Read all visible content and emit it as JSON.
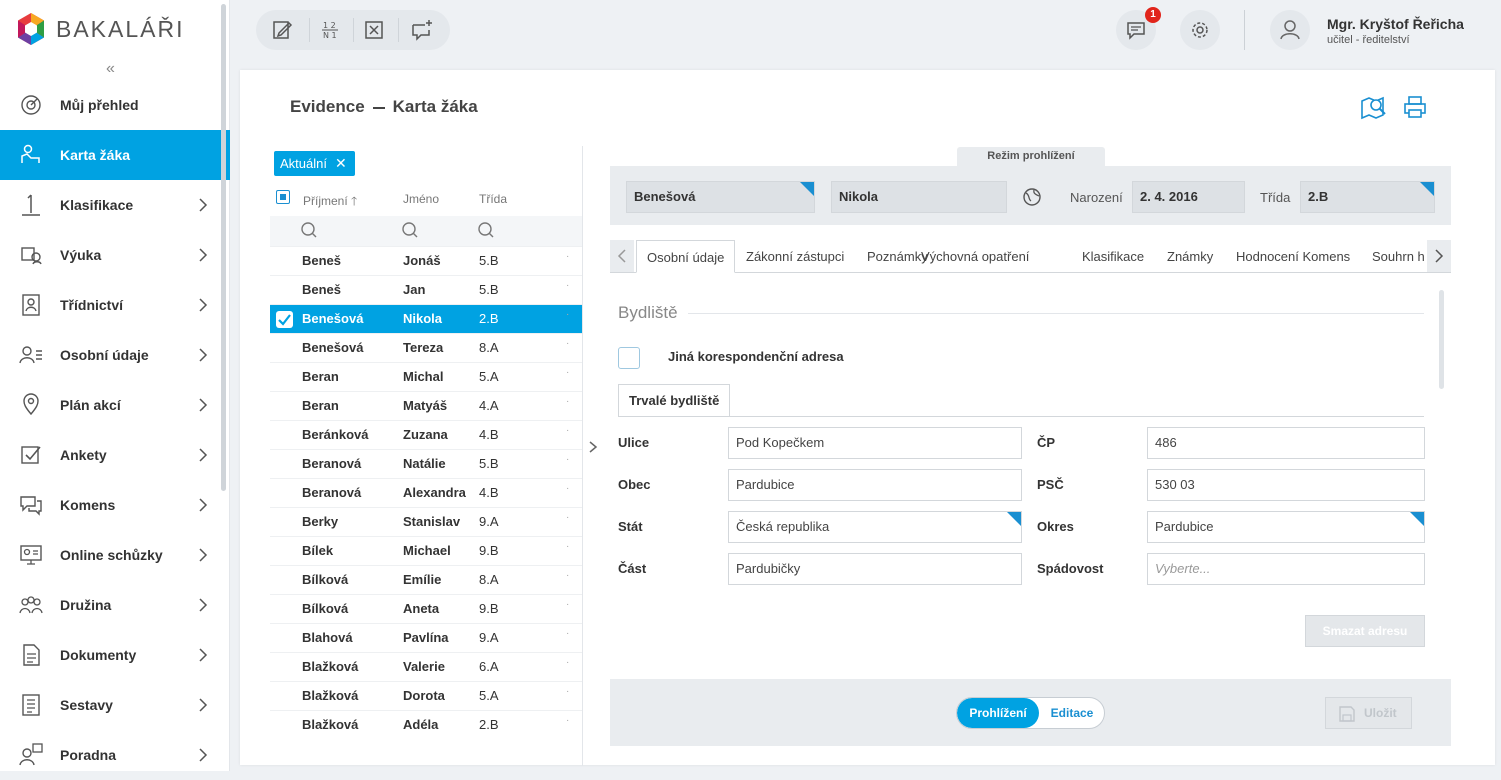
{
  "app": {
    "brand": "BAKALÁŘI",
    "user_name": "Mgr. Kryštof Řeřicha",
    "user_role": "učitel - ředitelství",
    "notif_count": "1",
    "accent": "#00a2e2"
  },
  "sidebar": {
    "items": [
      {
        "label": "Můj přehled",
        "icon": "dashboard-icon",
        "chevron": false
      },
      {
        "label": "Karta žáka",
        "icon": "student-card-icon",
        "chevron": false,
        "active": true
      },
      {
        "label": "Klasifikace",
        "icon": "grade-one-icon",
        "chevron": true
      },
      {
        "label": "Výuka",
        "icon": "teaching-icon",
        "chevron": true
      },
      {
        "label": "Třídnictví",
        "icon": "class-teacher-icon",
        "chevron": true
      },
      {
        "label": "Osobní údaje",
        "icon": "personal-data-icon",
        "chevron": true
      },
      {
        "label": "Plán akcí",
        "icon": "map-pin-icon",
        "chevron": true
      },
      {
        "label": "Ankety",
        "icon": "survey-check-icon",
        "chevron": true
      },
      {
        "label": "Komens",
        "icon": "chat-bubbles-icon",
        "chevron": true
      },
      {
        "label": "Online schůzky",
        "icon": "online-meeting-icon",
        "chevron": true
      },
      {
        "label": "Družina",
        "icon": "group-icon",
        "chevron": true
      },
      {
        "label": "Dokumenty",
        "icon": "document-icon",
        "chevron": true
      },
      {
        "label": "Sestavy",
        "icon": "report-icon",
        "chevron": true
      },
      {
        "label": "Poradna",
        "icon": "counseling-icon",
        "chevron": true
      }
    ]
  },
  "toolbar": {
    "icons": [
      "edit-note-icon",
      "numbering-icon",
      "close-box-icon",
      "add-comment-icon"
    ]
  },
  "page": {
    "crumb_section": "Evidence",
    "crumb_page": "Karta žáka"
  },
  "list": {
    "filter_tag": "Aktuální",
    "col_surname": "Příjmení",
    "col_name": "Jméno",
    "col_class": "Třída",
    "rows": [
      {
        "surname": "Beneš",
        "name": "Jonáš",
        "class": "5.B"
      },
      {
        "surname": "Beneš",
        "name": "Jan",
        "class": "5.B"
      },
      {
        "surname": "Benešová",
        "name": "Nikola",
        "class": "2.B",
        "selected": true
      },
      {
        "surname": "Benešová",
        "name": "Tereza",
        "class": "8.A"
      },
      {
        "surname": "Beran",
        "name": "Michal",
        "class": "5.A"
      },
      {
        "surname": "Beran",
        "name": "Matyáš",
        "class": "4.A"
      },
      {
        "surname": "Beránková",
        "name": "Zuzana",
        "class": "4.B"
      },
      {
        "surname": "Beranová",
        "name": "Natálie",
        "class": "5.B"
      },
      {
        "surname": "Beranová",
        "name": "Alexandra",
        "class": "4.B"
      },
      {
        "surname": "Berky",
        "name": "Stanislav",
        "class": "9.A"
      },
      {
        "surname": "Bílek",
        "name": "Michael",
        "class": "9.B"
      },
      {
        "surname": "Bílková",
        "name": "Emílie",
        "class": "8.A"
      },
      {
        "surname": "Bílková",
        "name": "Aneta",
        "class": "9.B"
      },
      {
        "surname": "Blahová",
        "name": "Pavlína",
        "class": "9.A"
      },
      {
        "surname": "Blažková",
        "name": "Valerie",
        "class": "6.A"
      },
      {
        "surname": "Blažková",
        "name": "Dorota",
        "class": "5.A"
      },
      {
        "surname": "Blažková",
        "name": "Adéla",
        "class": "2.B"
      }
    ]
  },
  "student": {
    "mode_label": "Režim prohlížení",
    "surname": "Benešová",
    "name": "Nikola",
    "birth_label": "Narození",
    "birth": "2. 4. 2016",
    "class_label": "Třída",
    "class": "2.B"
  },
  "tabs": [
    "Osobní údaje",
    "Zákonní zástupci",
    "Poznámky",
    "Výchovná opatření",
    "Klasifikace",
    "Známky",
    "Hodnocení Komens",
    "Souhrn h"
  ],
  "form": {
    "section_title": "Bydliště",
    "corr_label": "Jiná korespondenční adresa",
    "subtab": "Trvalé bydliště",
    "street_label": "Ulice",
    "street": "Pod Kopečkem",
    "cp_label": "ČP",
    "cp": "486",
    "city_label": "Obec",
    "city": "Pardubice",
    "zip_label": "PSČ",
    "zip": "530 03",
    "state_label": "Stát",
    "state": "Česká republika",
    "district_label": "Okres",
    "district": "Pardubice",
    "part_label": "Část",
    "part": "Pardubičky",
    "catchment_label": "Spádovost",
    "catchment_placeholder": "Vyberte...",
    "delete_button": "Smazat adresu"
  },
  "footer": {
    "mode_view": "Prohlížení",
    "mode_edit": "Editace",
    "save": "Uložit"
  }
}
